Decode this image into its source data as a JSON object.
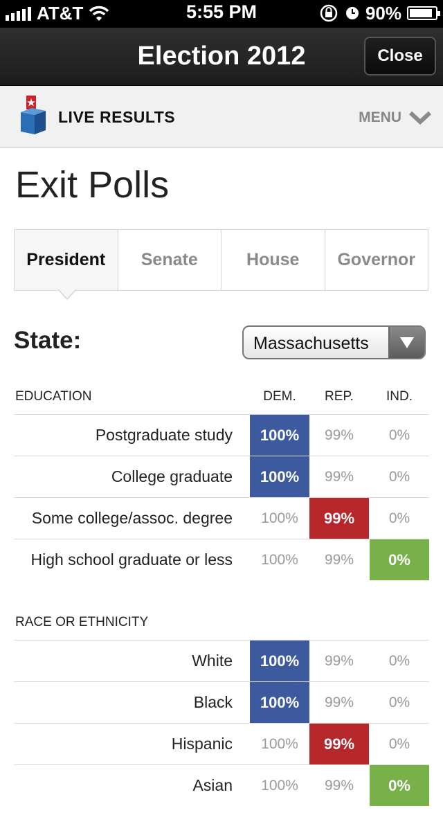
{
  "status_bar": {
    "carrier": "AT&T",
    "time": "5:55 PM",
    "battery": "90%",
    "battery_level": 0.9
  },
  "navbar": {
    "title": "Election 2012",
    "close_label": "Close"
  },
  "header": {
    "label": "LIVE RESULTS",
    "menu_label": "MENU"
  },
  "page_title": "Exit Polls",
  "tabs": [
    {
      "label": "President",
      "active": true
    },
    {
      "label": "Senate",
      "active": false
    },
    {
      "label": "House",
      "active": false
    },
    {
      "label": "Governor",
      "active": false
    }
  ],
  "state": {
    "label": "State:",
    "selected": "Massachusetts"
  },
  "colors": {
    "dem": "#3d5a9e",
    "rep": "#b5272b",
    "ind": "#78b04a"
  },
  "columns": {
    "dem": "DEM.",
    "rep": "REP.",
    "ind": "IND."
  },
  "sections": [
    {
      "title": "EDUCATION",
      "rows": [
        {
          "label": "Postgraduate study",
          "dem": "100%",
          "rep": "99%",
          "ind": "0%",
          "highlight": "dem"
        },
        {
          "label": "College graduate",
          "dem": "100%",
          "rep": "99%",
          "ind": "0%",
          "highlight": "dem"
        },
        {
          "label": "Some college/assoc. degree",
          "dem": "100%",
          "rep": "99%",
          "ind": "0%",
          "highlight": "rep"
        },
        {
          "label": "High school graduate or less",
          "dem": "100%",
          "rep": "99%",
          "ind": "0%",
          "highlight": "ind"
        }
      ]
    },
    {
      "title": "RACE OR ETHNICITY",
      "rows": [
        {
          "label": "White",
          "dem": "100%",
          "rep": "99%",
          "ind": "0%",
          "highlight": "dem"
        },
        {
          "label": "Black",
          "dem": "100%",
          "rep": "99%",
          "ind": "0%",
          "highlight": "dem"
        },
        {
          "label": "Hispanic",
          "dem": "100%",
          "rep": "99%",
          "ind": "0%",
          "highlight": "rep"
        },
        {
          "label": "Asian",
          "dem": "100%",
          "rep": "99%",
          "ind": "0%",
          "highlight": "ind"
        }
      ]
    }
  ]
}
